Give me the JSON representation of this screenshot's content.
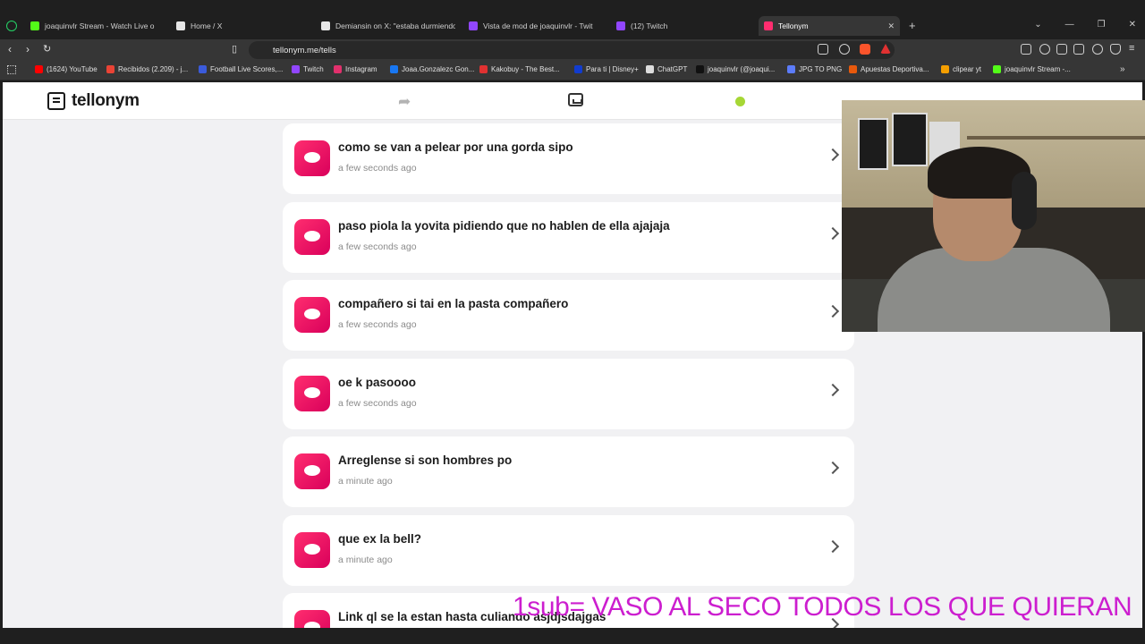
{
  "browser": {
    "tabs": [
      {
        "label": "joaquinvlr Stream - Watch Live o",
        "color": "#53fc18",
        "active": false
      },
      {
        "label": "Home / X",
        "color": "#e6e6e6",
        "active": false
      },
      {
        "label": "Demiansin on X: \"estaba durmiendo",
        "color": "#e6e6e6",
        "active": false
      },
      {
        "label": "Vista de mod de joaquinvlr - Twit",
        "color": "#9146ff",
        "active": false
      },
      {
        "label": "(12) Twitch",
        "color": "#9146ff",
        "active": false
      },
      {
        "label": "Tellonym",
        "color": "#ff2d6f",
        "active": true
      }
    ],
    "url": "tellonym.me/tells",
    "bookmarks": [
      {
        "label": "(1624) YouTube",
        "color": "#ff0000"
      },
      {
        "label": "Recibidos (2.209) - j...",
        "color": "#ea4335"
      },
      {
        "label": "Football Live Scores,...",
        "color": "#3b5bdb"
      },
      {
        "label": "Twitch",
        "color": "#9146ff"
      },
      {
        "label": "Instagram",
        "color": "#e1306c"
      },
      {
        "label": "Joaa.Gonzalezc Gon...",
        "color": "#1877f2"
      },
      {
        "label": "Kakobuy - The Best...",
        "color": "#e03131"
      },
      {
        "label": "Para ti | Disney+",
        "color": "#113ccf"
      },
      {
        "label": "ChatGPT",
        "color": "#dddddd"
      },
      {
        "label": "joaquinvlr (@joaqui...",
        "color": "#111111"
      },
      {
        "label": "JPG TO PNG",
        "color": "#5c7cfa"
      },
      {
        "label": "Apuestas Deportiva...",
        "color": "#e8590c"
      },
      {
        "label": "clipear yt",
        "color": "#f59f00"
      },
      {
        "label": "joaquinvlr Stream -...",
        "color": "#53fc18"
      }
    ]
  },
  "app": {
    "brand": "tellonym",
    "tells": [
      {
        "message": "como se van a pelear por una gorda sipo",
        "time": "a few seconds ago"
      },
      {
        "message": "paso piola la yovita pidiendo que no hablen de ella ajajaja",
        "time": "a few seconds ago"
      },
      {
        "message": "compañero si tai en la pasta compañero",
        "time": "a few seconds ago"
      },
      {
        "message": "oe k pasoooo",
        "time": "a few seconds ago"
      },
      {
        "message": "Arreglense si son hombres po",
        "time": "a minute ago"
      },
      {
        "message": "que ex la bell?",
        "time": "a minute ago"
      },
      {
        "message": "Link ql se la estan hasta culiando asjdjsdajgas",
        "time": ""
      }
    ]
  },
  "stream_overlay": {
    "text": "1sub= VASO AL SECO TODOS LOS QUE QUIERAN"
  },
  "colors": {
    "accent": "#ff2d6f",
    "status_dot": "#a6d735",
    "overlay": "#cc1ecf"
  }
}
